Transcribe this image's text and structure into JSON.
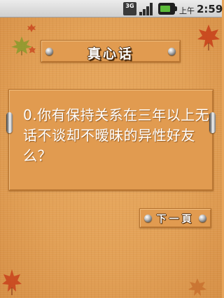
{
  "status_bar": {
    "network_badge": "3G",
    "ampm": "上午",
    "time": "2:59"
  },
  "header": {
    "title": "真心话"
  },
  "question": {
    "text": "0.你有保持关系在三年以上无话不谈却不暧昧的异性好友么？"
  },
  "actions": {
    "next_label": "下一頁"
  },
  "colors": {
    "background": "#e2a055",
    "board": "#e19b50",
    "text": "#ffffff",
    "leaf_red": "#c8421c",
    "leaf_green": "#8a9a2c"
  }
}
